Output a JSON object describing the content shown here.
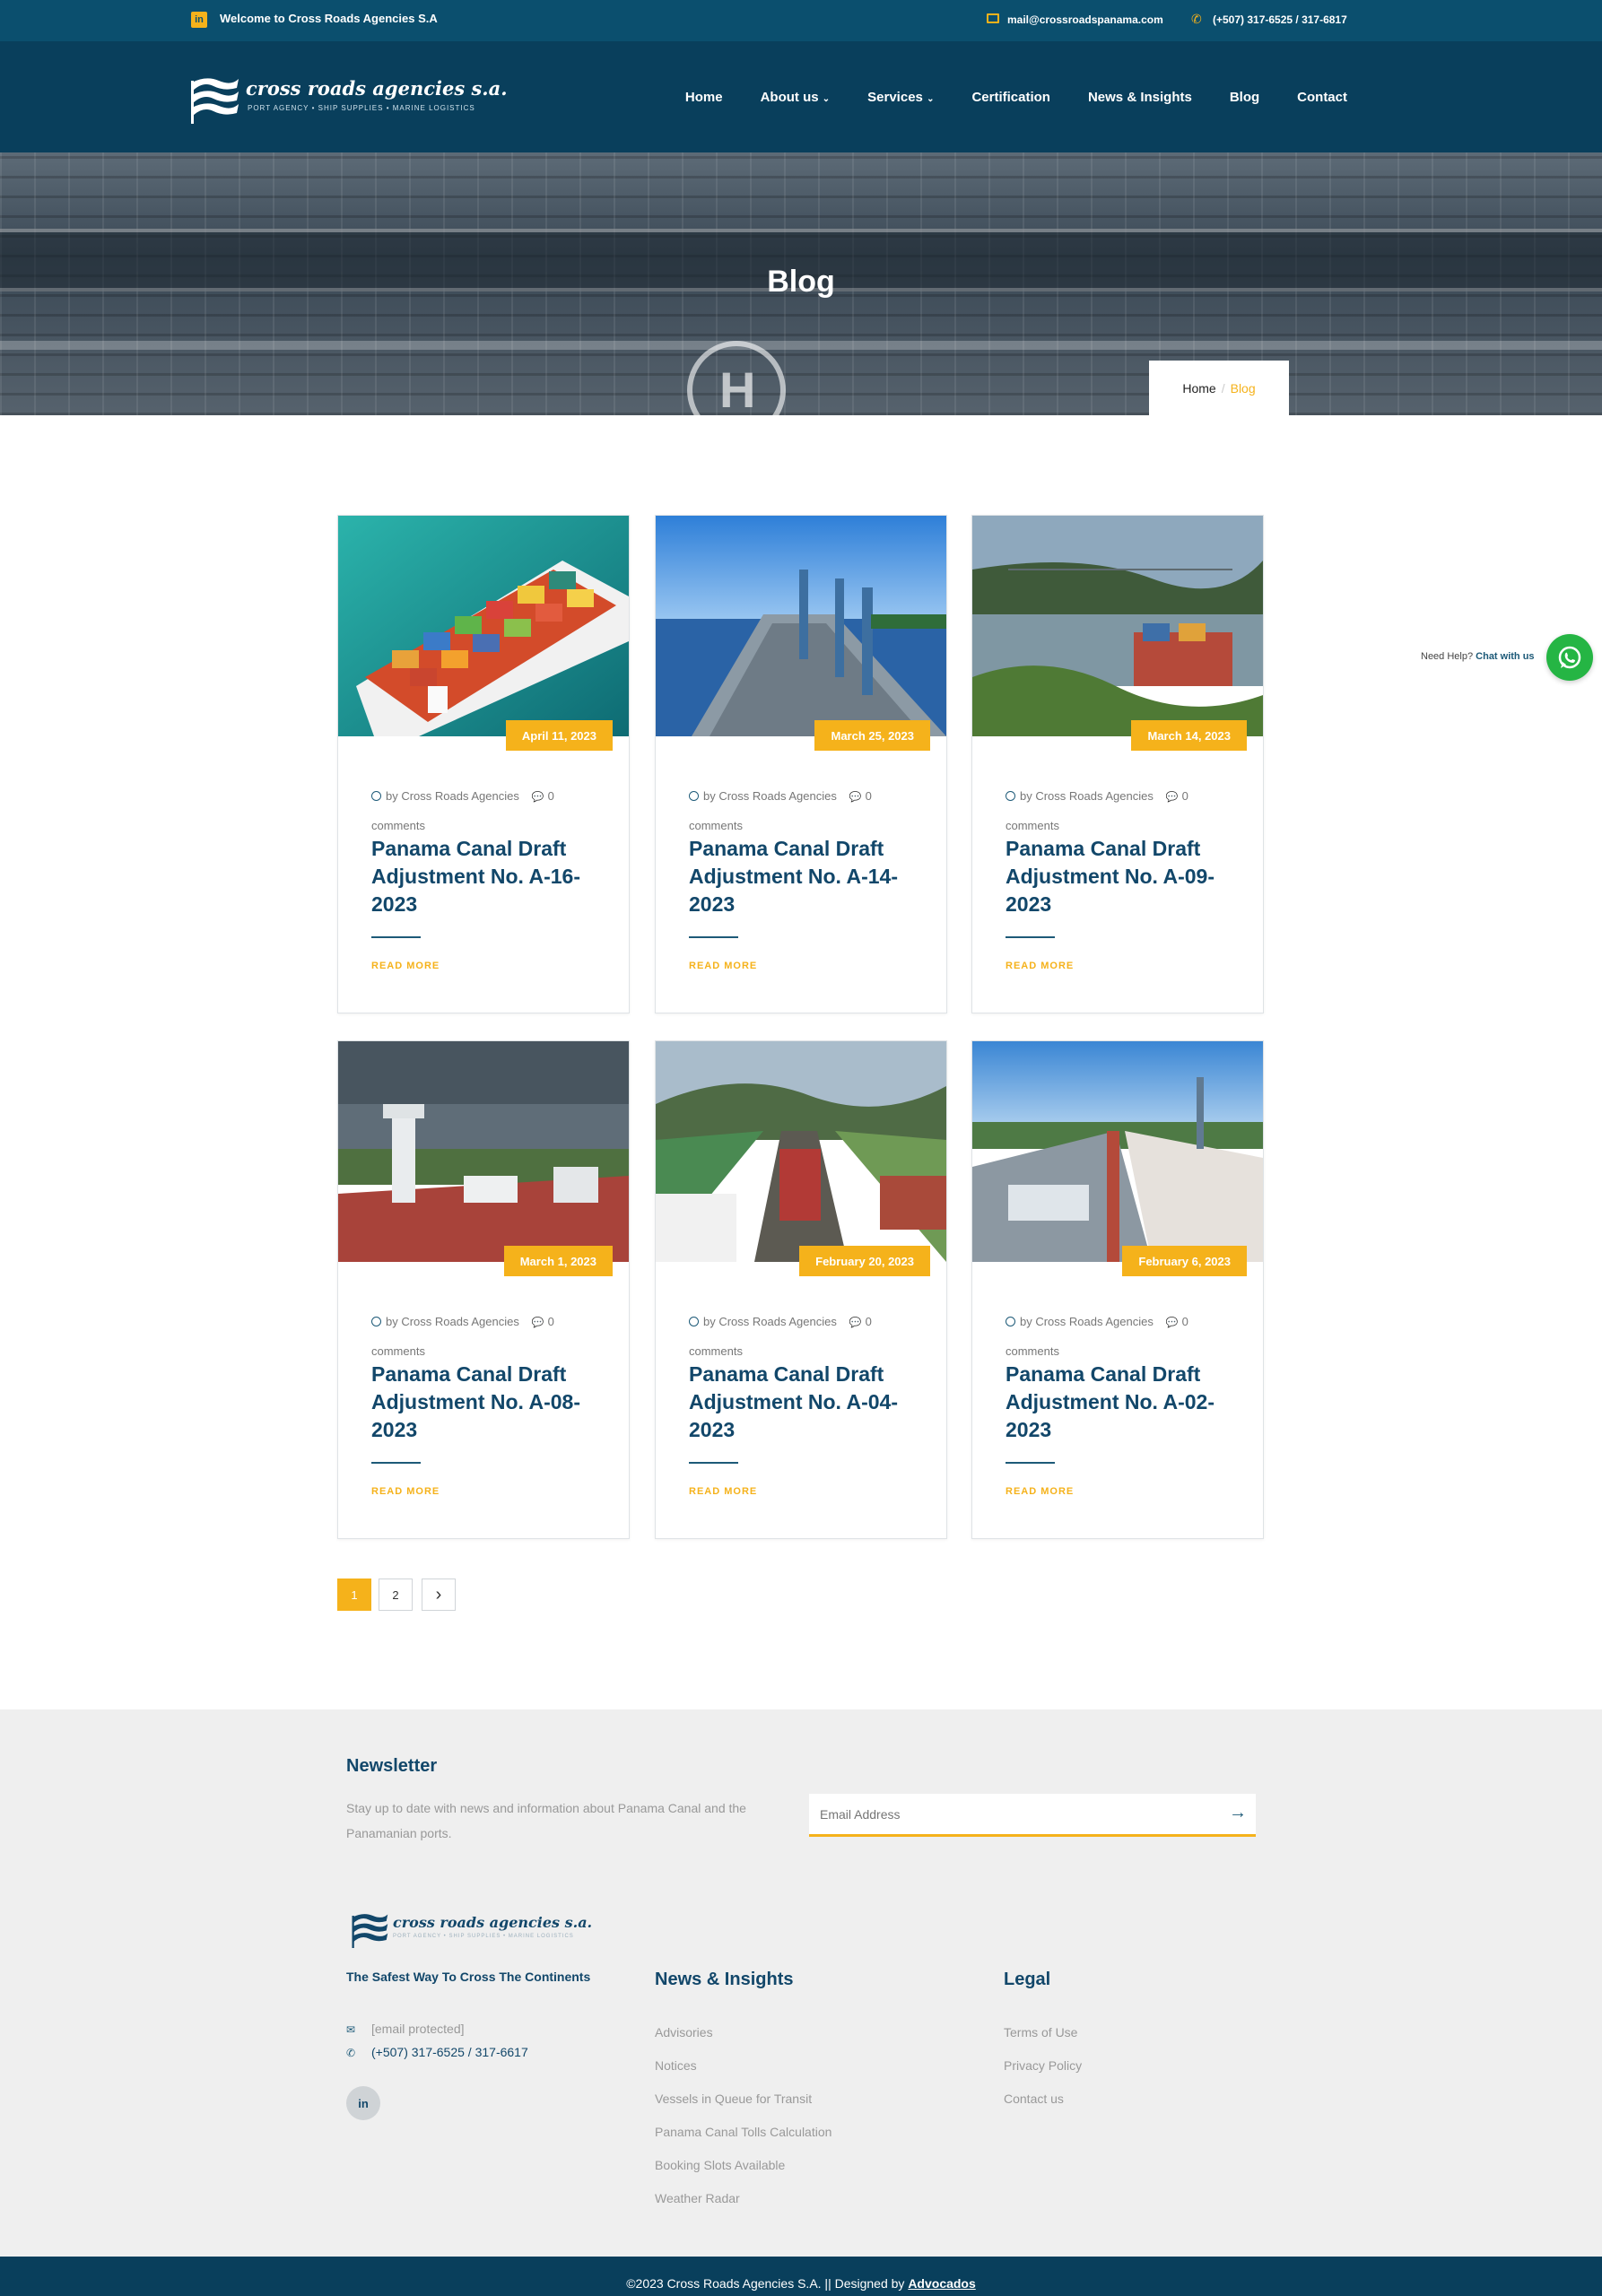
{
  "topbar": {
    "welcome": "Welcome to Cross Roads Agencies S.A",
    "email": "mail@crossroadspanama.com",
    "phone": "(+507) 317-6525 / 317-6817",
    "linkedin_glyph": "in"
  },
  "header": {
    "logo_name": "cross roads agencies s.a.",
    "logo_tagline": "PORT AGENCY  •  SHIP SUPPLIES  •  MARINE LOGISTICS",
    "nav": [
      {
        "label": "Home",
        "dropdown": false
      },
      {
        "label": "About us",
        "dropdown": true
      },
      {
        "label": "Services",
        "dropdown": true
      },
      {
        "label": "Certification",
        "dropdown": false
      },
      {
        "label": "News & Insights",
        "dropdown": false
      },
      {
        "label": "Blog",
        "dropdown": false
      },
      {
        "label": "Contact",
        "dropdown": false
      }
    ]
  },
  "hero": {
    "title": "Blog",
    "breadcrumb_home": "Home",
    "breadcrumb_sep": "/",
    "breadcrumb_current": "Blog"
  },
  "posts": [
    {
      "date": "April 11, 2023",
      "author": "by Cross Roads Agencies",
      "comments": "0",
      "comments_word": "comments",
      "title": "Panama Canal Draft Adjustment No. A-16-2023",
      "read_more": "READ MORE"
    },
    {
      "date": "March 25, 2023",
      "author": "by Cross Roads Agencies",
      "comments": "0",
      "comments_word": "comments",
      "title": "Panama Canal Draft Adjustment No. A-14-2023",
      "read_more": "READ MORE"
    },
    {
      "date": "March 14, 2023",
      "author": "by Cross Roads Agencies",
      "comments": "0",
      "comments_word": "comments",
      "title": "Panama Canal Draft Adjustment No. A-09-2023",
      "read_more": "READ MORE"
    },
    {
      "date": "March 1, 2023",
      "author": "by Cross Roads Agencies",
      "comments": "0",
      "comments_word": "comments",
      "title": "Panama Canal Draft Adjustment No. A-08-2023",
      "read_more": "READ MORE"
    },
    {
      "date": "February 20, 2023",
      "author": "by Cross Roads Agencies",
      "comments": "0",
      "comments_word": "comments",
      "title": "Panama Canal Draft Adjustment No. A-04-2023",
      "read_more": "READ MORE"
    },
    {
      "date": "February 6, 2023",
      "author": "by Cross Roads Agencies",
      "comments": "0",
      "comments_word": "comments",
      "title": "Panama Canal Draft Adjustment No. A-02-2023",
      "read_more": "READ MORE"
    }
  ],
  "pagination": {
    "pages": [
      "1",
      "2"
    ],
    "active": "1",
    "next_glyph": "›"
  },
  "whatsapp": {
    "need_help": "Need Help?",
    "chat": "Chat with us"
  },
  "footer": {
    "newsletter_title": "Newsletter",
    "newsletter_text": "Stay up to date with news and information about Panama Canal and the Panamanian ports.",
    "email_placeholder": "Email Address",
    "submit_glyph": "→",
    "logo_name": "cross roads agencies s.a.",
    "logo_tagline": "PORT AGENCY  •  SHIP SUPPLIES  •  MARINE LOGISTICS",
    "tagline": "The Safest Way To Cross The Continents",
    "email": "[email protected]",
    "phone": "(+507) 317-6525 / 317-6617",
    "linkedin_glyph": "in",
    "news_title": "News & Insights",
    "news_links": [
      "Advisories",
      "Notices",
      "Vessels in Queue for Transit",
      "Panama Canal Tolls Calculation",
      "Booking Slots Available",
      "Weather Radar"
    ],
    "legal_title": "Legal",
    "legal_links": [
      "Terms of Use",
      "Privacy Policy",
      "Contact us"
    ],
    "copyright": "©2023 Cross Roads Agencies S.A. || Designed by ",
    "designer": "Advocados"
  },
  "colors": {
    "primary": "#093f5c",
    "topbar": "#0b4f6e",
    "accent": "#f5b21b",
    "title": "#12476a",
    "whatsapp": "#25b544"
  }
}
